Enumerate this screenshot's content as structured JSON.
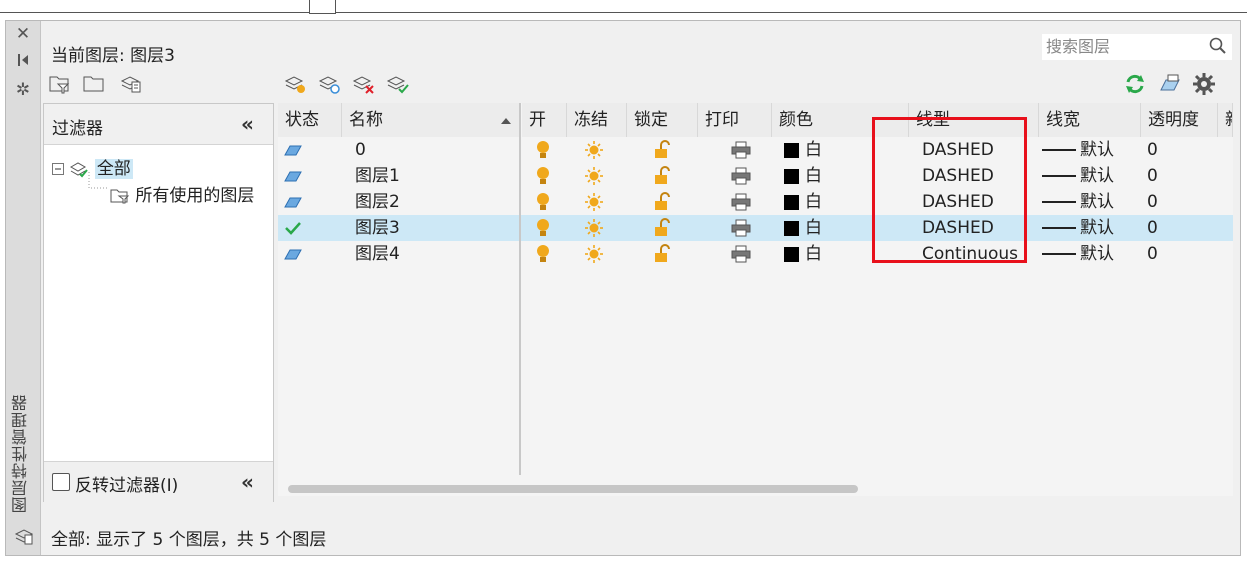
{
  "palette_title": "图层特性管理器",
  "current_layer": "当前图层: 图层3",
  "search": {
    "placeholder": "搜索图层"
  },
  "filter_panel": {
    "header": "过滤器",
    "tree_root": "全部",
    "tree_child": "所有使用的图层",
    "invert_label": "反转过滤器(I)",
    "invert_checked": false
  },
  "columns": [
    "状态",
    "名称",
    "开",
    "冻结",
    "锁定",
    "打印",
    "颜色",
    "线型",
    "线宽",
    "透明度",
    "新"
  ],
  "layers": [
    {
      "status": "layer-icon",
      "name": "0",
      "color": "白",
      "linetype": "DASHED",
      "lineweight": "默认",
      "transparency": "0",
      "selected": false
    },
    {
      "status": "layer-icon",
      "name": "图层1",
      "color": "白",
      "linetype": "DASHED",
      "lineweight": "默认",
      "transparency": "0",
      "selected": false
    },
    {
      "status": "layer-icon",
      "name": "图层2",
      "color": "白",
      "linetype": "DASHED",
      "lineweight": "默认",
      "transparency": "0",
      "selected": false
    },
    {
      "status": "current-check",
      "name": "图层3",
      "color": "白",
      "linetype": "DASHED",
      "lineweight": "默认",
      "transparency": "0",
      "selected": true
    },
    {
      "status": "layer-icon",
      "name": "图层4",
      "color": "白",
      "linetype": "Continuous",
      "lineweight": "默认",
      "transparency": "0",
      "selected": false
    }
  ],
  "status_bar": "全部: 显示了 5 个图层，共 5 个图层",
  "colors": {
    "accent_selected": "#cde8f6",
    "highlight_box": "#e8101b",
    "bulb": "#f0a81c",
    "refresh": "#2aa84a"
  }
}
